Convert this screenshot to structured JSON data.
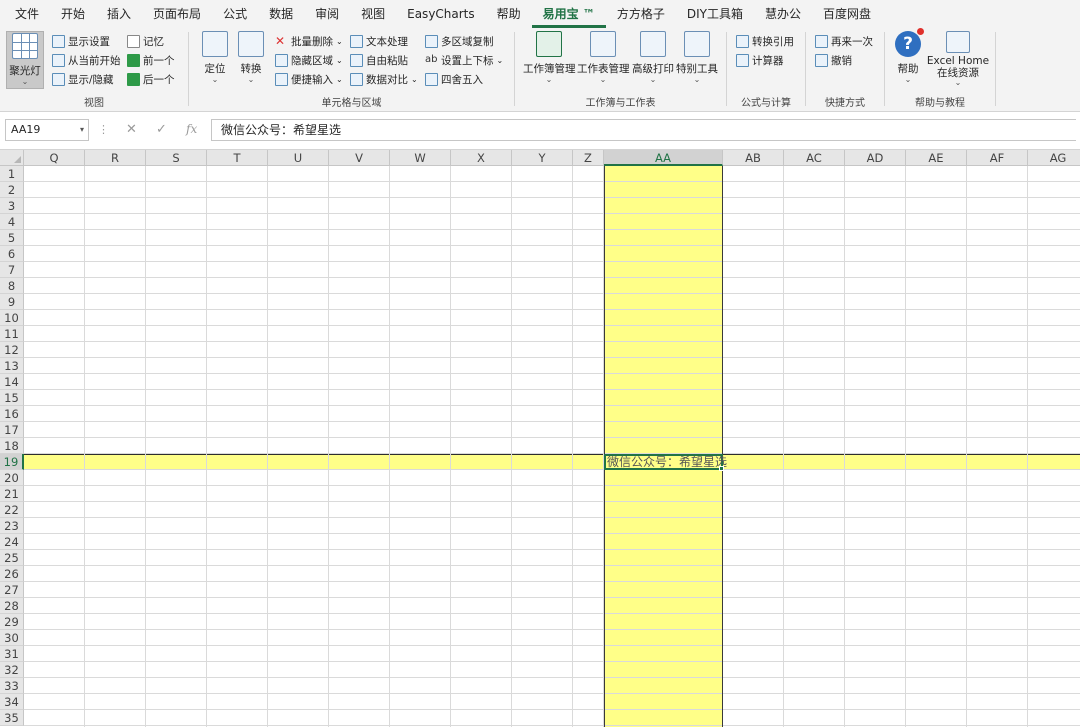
{
  "menu": {
    "tabs": [
      "文件",
      "开始",
      "插入",
      "页面布局",
      "公式",
      "数据",
      "审阅",
      "视图",
      "EasyCharts",
      "帮助",
      "易用宝 ™",
      "方方格子",
      "DIY工具箱",
      "慧办公",
      "百度网盘"
    ],
    "active_tab": "易用宝 ™"
  },
  "ribbon": {
    "view_group": {
      "label": "视图",
      "spotlight": "聚光灯",
      "display_settings": "显示设置",
      "from_current": "从当前开始",
      "show_hide": "显示/隐藏",
      "remember": "记忆",
      "prev": "前一个",
      "next": "后一个"
    },
    "cells_group": {
      "label": "单元格与区域",
      "locate": "定位",
      "convert": "转换",
      "batch_delete": "批量删除",
      "hide_area": "隐藏区域",
      "quick_input": "便捷输入",
      "text_process": "文本处理",
      "free_paste": "自由粘贴",
      "data_compare": "数据对比",
      "multi_copy": "多区域复制",
      "super_sub": "设置上下标",
      "round": "四舍五入"
    },
    "workbook_group": {
      "label": "工作簿与工作表",
      "workbook_mgmt": "工作簿管理",
      "sheet_mgmt": "工作表管理",
      "adv_print": "高级打印",
      "special_tools": "特别工具"
    },
    "formula_group": {
      "label": "公式与计算",
      "convert_ref": "转换引用",
      "calculator": "计算器"
    },
    "shortcut_group": {
      "label": "快捷方式",
      "redo": "再来一次",
      "undo": "撤销"
    },
    "help_group": {
      "label": "帮助与教程",
      "help": "帮助",
      "excel_home_1": "Excel Home",
      "excel_home_2": "在线资源"
    }
  },
  "formula_bar": {
    "name_box": "AA19",
    "fx": "fx",
    "cancel": "✕",
    "enter": "✓",
    "content": "微信公众号：希望星选"
  },
  "sheet": {
    "columns": [
      "Q",
      "R",
      "S",
      "T",
      "U",
      "V",
      "W",
      "X",
      "Y",
      "Z",
      "AA",
      "AB",
      "AC",
      "AD",
      "AE",
      "AF",
      "AG"
    ],
    "rows": [
      "1",
      "2",
      "3",
      "4",
      "5",
      "6",
      "7",
      "8",
      "9",
      "10",
      "11",
      "12",
      "13",
      "14",
      "15",
      "16",
      "17",
      "18",
      "19",
      "20",
      "21",
      "22",
      "23",
      "24",
      "25",
      "26",
      "27",
      "28",
      "29",
      "30",
      "31",
      "32",
      "33",
      "34",
      "35"
    ],
    "active_column": "AA",
    "active_row": "19",
    "active_cell_text": "微信公众号：希望星选",
    "highlight_color": "#ffff88",
    "accent_color": "#217346"
  }
}
